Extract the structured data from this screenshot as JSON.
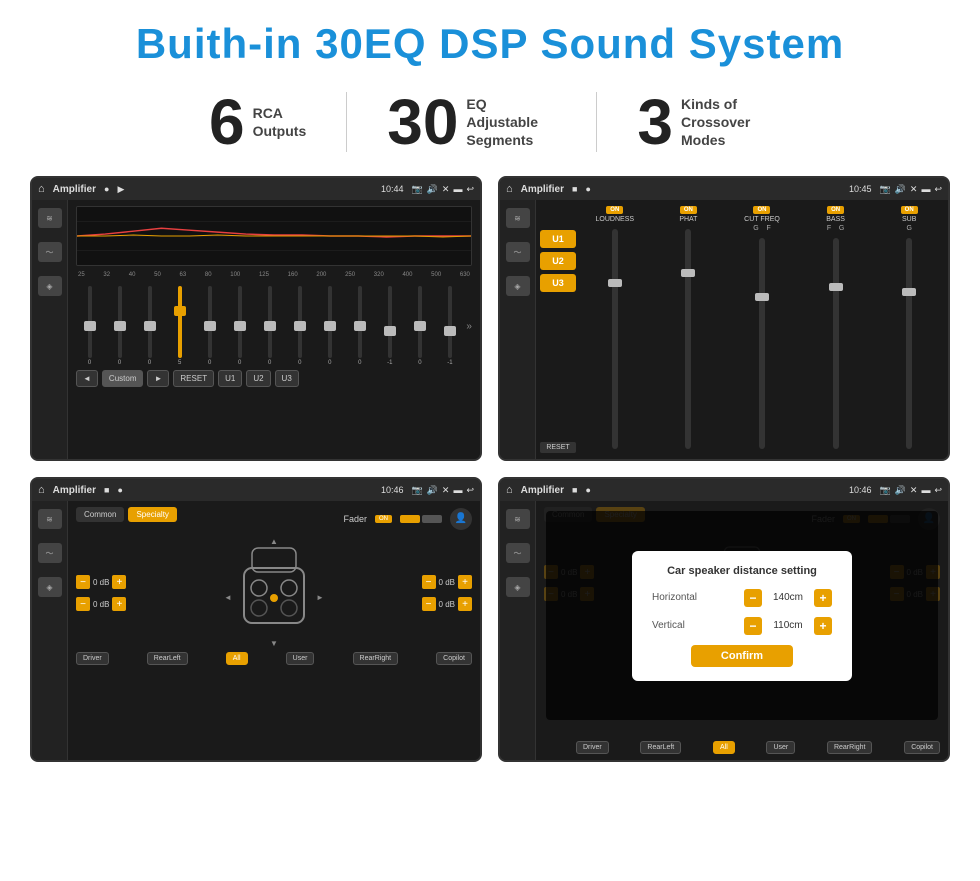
{
  "page": {
    "title": "Buith-in 30EQ DSP Sound System",
    "stats": [
      {
        "number": "6",
        "label": "RCA\nOutputs"
      },
      {
        "number": "30",
        "label": "EQ Adjustable\nSegments"
      },
      {
        "number": "3",
        "label": "Kinds of\nCrossover Modes"
      }
    ]
  },
  "screens": {
    "eq": {
      "topbar": {
        "title": "Amplifier",
        "time": "10:44"
      },
      "freq_labels": [
        "25",
        "32",
        "40",
        "50",
        "63",
        "80",
        "100",
        "125",
        "160",
        "200",
        "250",
        "320",
        "400",
        "500",
        "630"
      ],
      "slider_values": [
        "0",
        "0",
        "0",
        "5",
        "0",
        "0",
        "0",
        "0",
        "0",
        "0",
        "-1",
        "0",
        "-1"
      ],
      "buttons": [
        "◄",
        "Custom",
        "►",
        "RESET",
        "U1",
        "U2",
        "U3"
      ]
    },
    "crossover": {
      "topbar": {
        "title": "Amplifier",
        "time": "10:45"
      },
      "u_buttons": [
        "U1",
        "U2",
        "U3"
      ],
      "channels": [
        {
          "label": "LOUDNESS",
          "on": true
        },
        {
          "label": "PHAT",
          "on": true
        },
        {
          "label": "CUT FREQ",
          "on": true
        },
        {
          "label": "BASS",
          "on": true
        },
        {
          "label": "SUB",
          "on": true
        }
      ],
      "reset_label": "RESET"
    },
    "fader": {
      "topbar": {
        "title": "Amplifier",
        "time": "10:46"
      },
      "tabs": [
        "Common",
        "Specialty"
      ],
      "fader_label": "Fader",
      "fader_on": "ON",
      "db_values": [
        "0 dB",
        "0 dB",
        "0 dB",
        "0 dB"
      ],
      "bottom_btns": [
        "Driver",
        "RearLeft",
        "All",
        "User",
        "RearRight",
        "Copilot"
      ]
    },
    "distance": {
      "topbar": {
        "title": "Amplifier",
        "time": "10:46"
      },
      "tabs": [
        "Common",
        "Specialty"
      ],
      "dialog": {
        "title": "Car speaker distance setting",
        "rows": [
          {
            "label": "Horizontal",
            "value": "140cm"
          },
          {
            "label": "Vertical",
            "value": "110cm"
          }
        ],
        "confirm_btn": "Confirm"
      },
      "bottom_btns": [
        "Driver",
        "RearLeft",
        "All",
        "User",
        "RearRight",
        "Copilot"
      ]
    }
  }
}
